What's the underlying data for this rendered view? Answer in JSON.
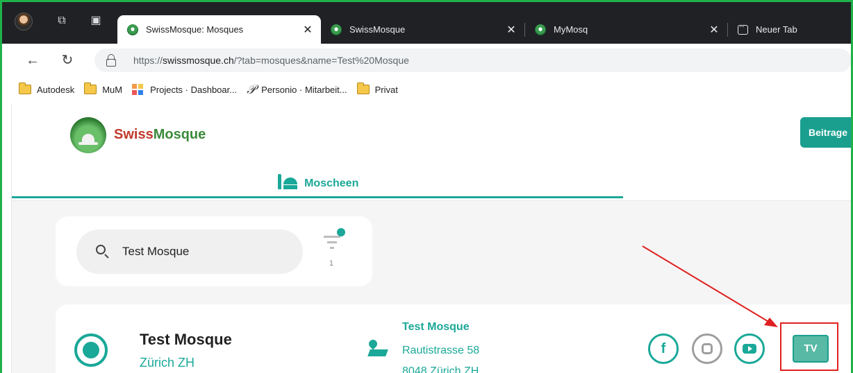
{
  "browser": {
    "tabs": [
      {
        "title": "SwissMosque: Mosques",
        "active": true
      },
      {
        "title": "SwissMosque",
        "active": false
      },
      {
        "title": "MyMosq",
        "active": false
      },
      {
        "title": "Neuer Tab",
        "active": false
      }
    ],
    "close_glyph": "✕",
    "url_prefix": "https://",
    "url_host": "swissmosque.ch",
    "url_rest": "/?tab=mosques&name=Test%20Mosque",
    "bookmarks": [
      "Autodesk",
      "MuM",
      "Projects · Dashboar...",
      "Personio · Mitarbeit...",
      "Privat"
    ]
  },
  "page": {
    "brand_swiss": "Swiss",
    "brand_mosque": "Mosque",
    "contribute_button": "Beitrage",
    "nav_tab": "Moscheen",
    "search_value": "Test Mosque",
    "filter_count": "1",
    "mosque": {
      "name": "Test Mosque",
      "city": "Zürich ZH",
      "address_name": "Test Mosque",
      "street": "Rautistrasse 58",
      "zip_city": "8048 Zürich ZH"
    },
    "tv_button": "TV"
  },
  "colors": {
    "accent": "#1aa898",
    "brand_red": "#c0392b",
    "brand_green": "#3a8a3a",
    "annotation": "#e02020",
    "window_border": "#1fb24a"
  }
}
